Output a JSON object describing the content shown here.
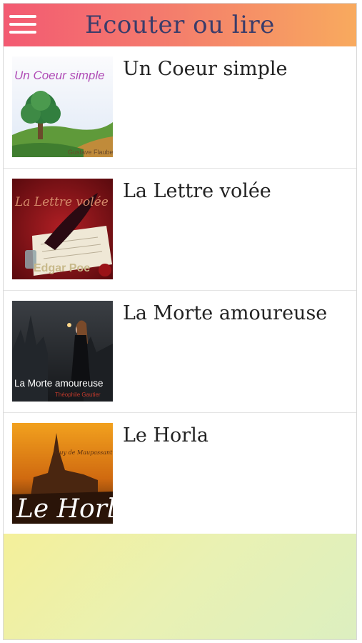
{
  "header": {
    "title": "Ecouter ou lire",
    "menu_icon": "hamburger-menu-icon",
    "gradient": [
      "#f35a72",
      "#f8aa5e"
    ],
    "title_color": "#3a3c6a"
  },
  "books": [
    {
      "title": "Un Coeur simple",
      "cover": {
        "title": "Un Coeur simple",
        "author": "Gustave Flaubert"
      }
    },
    {
      "title": "La Lettre volée",
      "cover": {
        "title": "La Lettre volée",
        "author": "Edgar Poe"
      }
    },
    {
      "title": "La Morte amoureuse",
      "cover": {
        "title": "La Morte amoureuse",
        "author": "Théophile Gautier"
      }
    },
    {
      "title": "Le Horla",
      "cover": {
        "title": "Le Horla",
        "author": "Guy de Maupassant"
      }
    }
  ],
  "footer_gradient": [
    "#f4f09a",
    "#dcefc0"
  ]
}
